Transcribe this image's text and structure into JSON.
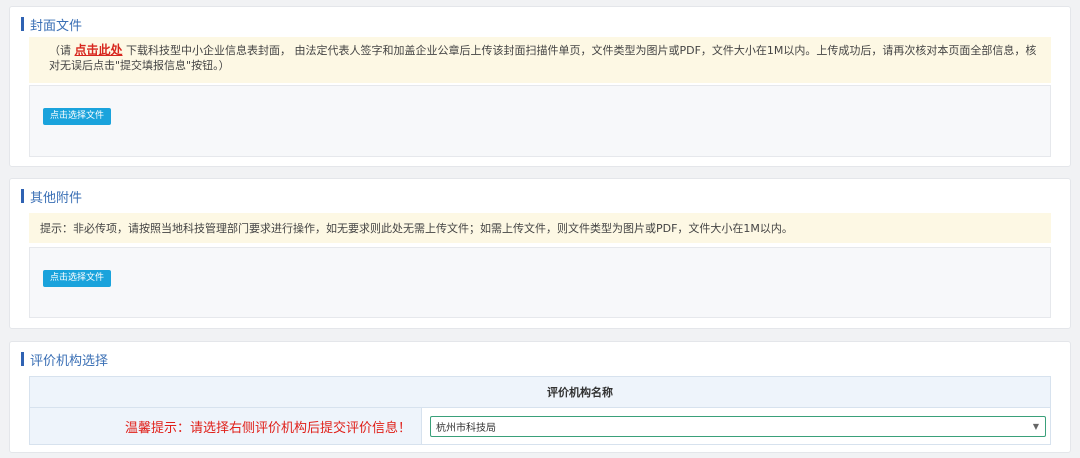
{
  "cover": {
    "title": "封面文件",
    "notice_prefix": "（请 ",
    "notice_link": "点击此处",
    "notice_text": " 下载科技型中小企业信息表封面， 由法定代表人签字和加盖企业公章后上传该封面扫描件单页，文件类型为图片或PDF，文件大小在1M以内。上传成功后，请再次核对本页面全部信息，核对无误后点击\"提交填报信息\"按钮。）",
    "upload_label": "点击选择文件"
  },
  "other": {
    "title": "其他附件",
    "notice_text": "提示：非必传项，请按照当地科技管理部门要求进行操作，如无要求则此处无需上传文件；如需上传文件，则文件类型为图片或PDF，文件大小在1M以内。",
    "upload_label": "点击选择文件"
  },
  "org": {
    "title": "评价机构选择",
    "column_header": "评价机构名称",
    "warning": "温馨提示：请选择右侧评价机构后提交评价信息！",
    "selected": "杭州市科技局"
  },
  "colors": {
    "accent": "#2f62b3",
    "button": "#1aa3dc",
    "warning": "#e0201a",
    "notice_bg": "#fdf8e4"
  }
}
